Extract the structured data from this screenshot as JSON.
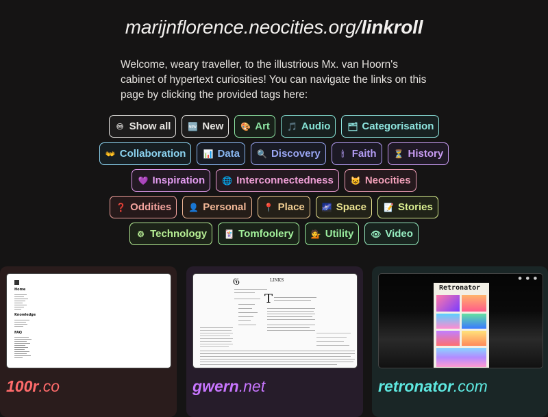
{
  "header": {
    "site": "marijnflorence.neocities.org/",
    "page": "linkroll"
  },
  "intro": "Welcome, weary traveller, to the illustrious Mx. van Hoorn's cabinet of hypertext curiosities! You can navigate the links on this page by clicking the provided tags here:",
  "tag_rows": [
    [
      {
        "label": "Show all",
        "icon": "infinity-icon",
        "glyph": "♾",
        "color": "#e8e6e3",
        "bg": "#1d1c1c"
      },
      {
        "label": "New",
        "icon": "new-icon",
        "glyph": "🆕",
        "color": "#e8e6e3",
        "bg": "#1d1c1c"
      },
      {
        "label": "Art",
        "icon": "palette-icon",
        "glyph": "🎨",
        "color": "#8ee6a4",
        "bg": "#182019"
      },
      {
        "label": "Audio",
        "icon": "music-icon",
        "glyph": "🎵",
        "color": "#86e3d5",
        "bg": "#17201f"
      },
      {
        "label": "Categorisation",
        "icon": "card-index-icon",
        "glyph": "🗂",
        "color": "#8fe6e0",
        "bg": "#172121"
      }
    ],
    [
      {
        "label": "Collaboration",
        "icon": "handshake-icon",
        "glyph": "👐",
        "color": "#8cd3f0",
        "bg": "#161e22"
      },
      {
        "label": "Data",
        "icon": "chart-icon",
        "glyph": "📊",
        "color": "#8ab8f2",
        "bg": "#171b24"
      },
      {
        "label": "Discovery",
        "icon": "magnifier-icon",
        "glyph": "🔍",
        "color": "#9aa6f3",
        "bg": "#191b25"
      },
      {
        "label": "Faith",
        "icon": "candle-icon",
        "glyph": "🕯",
        "color": "#b39cf4",
        "bg": "#1c1925"
      },
      {
        "label": "History",
        "icon": "hourglass-icon",
        "glyph": "⏳",
        "color": "#c89cf2",
        "bg": "#1f1925"
      }
    ],
    [
      {
        "label": "Inspiration",
        "icon": "heart-icon",
        "glyph": "💜",
        "color": "#e39cf0",
        "bg": "#221923"
      },
      {
        "label": "Interconnectedness",
        "icon": "globe-icon",
        "glyph": "🌐",
        "color": "#ef9fd6",
        "bg": "#241920"
      },
      {
        "label": "Neocities",
        "icon": "cat-icon",
        "glyph": "😺",
        "color": "#f2a0b9",
        "bg": "#25191d"
      }
    ],
    [
      {
        "label": "Oddities",
        "icon": "question-icon",
        "glyph": "❓",
        "color": "#f3a39e",
        "bg": "#26191a"
      },
      {
        "label": "Personal",
        "icon": "person-icon",
        "glyph": "👤",
        "color": "#f1b796",
        "bg": "#251d18"
      },
      {
        "label": "Place",
        "icon": "pin-icon",
        "glyph": "📍",
        "color": "#f0cd92",
        "bg": "#242018"
      },
      {
        "label": "Space",
        "icon": "galaxy-icon",
        "glyph": "🌌",
        "color": "#e9e290",
        "bg": "#222218"
      },
      {
        "label": "Stories",
        "icon": "memo-icon",
        "glyph": "📝",
        "color": "#d9ee90",
        "bg": "#202318"
      }
    ],
    [
      {
        "label": "Technology",
        "icon": "gear-icon",
        "glyph": "⚙",
        "color": "#b7ee95",
        "bg": "#1c2318"
      },
      {
        "label": "Tomfoolery",
        "icon": "star-box-icon",
        "glyph": "🃏",
        "color": "#a2ef9a",
        "bg": "#1a2319"
      },
      {
        "label": "Utility",
        "icon": "worker-icon",
        "glyph": "💁",
        "color": "#9aee9f",
        "bg": "#192319"
      },
      {
        "label": "Video",
        "icon": "eye-icon",
        "glyph": "👁",
        "color": "#96ecc0",
        "bg": "#18231e"
      }
    ]
  ],
  "cards": [
    {
      "name": "100r",
      "tld": ".co",
      "color": "#ff6b6b",
      "bg": "#2a1c1c"
    },
    {
      "name": "gwern",
      "tld": ".net",
      "color": "#c876ff",
      "bg": "#261c2a"
    },
    {
      "name": "retronator",
      "tld": ".com",
      "color": "#5ee8e0",
      "bg": "#1a2626"
    }
  ],
  "thumb_text": {
    "gwern_heading": "LINKS",
    "retronator_logo": "Retronator",
    "hundredr_sections": [
      "Home",
      "Knowledge",
      "FAQ"
    ]
  }
}
